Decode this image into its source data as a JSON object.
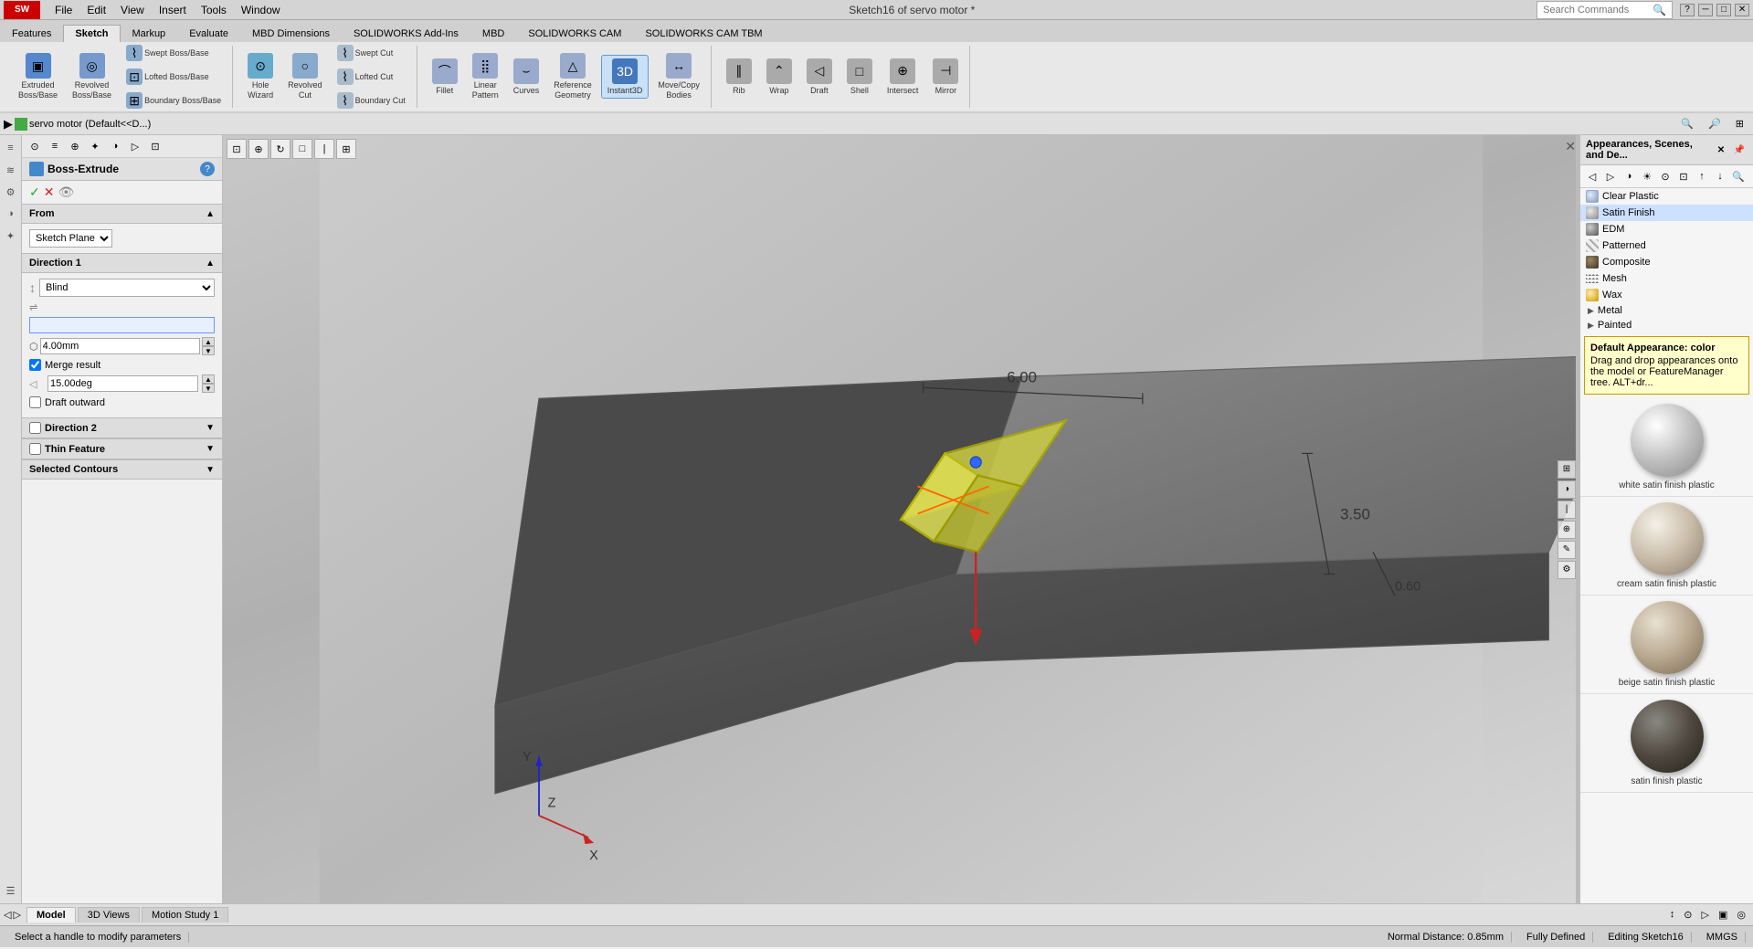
{
  "app": {
    "title": "Sketch16 of servo motor *",
    "logo": "SW"
  },
  "menu": {
    "items": [
      "File",
      "Edit",
      "View",
      "Insert",
      "Tools",
      "Window"
    ]
  },
  "ribbon_tabs": [
    "Features",
    "Sketch",
    "Markup",
    "Evaluate",
    "MBD Dimensions",
    "SOLIDWORKS Add-Ins",
    "MBD",
    "SOLIDWORKS CAM",
    "SOLIDWORKS CAM TBM"
  ],
  "active_tab": "Sketch",
  "ribbon_groups": {
    "features": [
      {
        "label": "Extruded\nBoss/Base",
        "icon": "▣"
      },
      {
        "label": "Revolved\nBoss/Base",
        "icon": "◎"
      },
      {
        "label": "Swept Boss/Base",
        "icon": "⌇"
      },
      {
        "label": "Lofted Boss/Base",
        "icon": "⊡"
      },
      {
        "label": "Boundary Boss/Base",
        "icon": "⊞"
      },
      {
        "label": "Hole\nWizard",
        "icon": "⊙"
      },
      {
        "label": "Revolved\nCut",
        "icon": "○"
      },
      {
        "label": "Swept Cut",
        "icon": "⌇"
      },
      {
        "label": "Lofted Cut",
        "icon": "⌇"
      },
      {
        "label": "Boundary Cut",
        "icon": "⌇"
      },
      {
        "label": "Fillet",
        "icon": "⌒"
      },
      {
        "label": "Linear\nPattern",
        "icon": "⣿"
      },
      {
        "label": "Curves",
        "icon": "⌣"
      },
      {
        "label": "Reference\nGeometry",
        "icon": "△"
      },
      {
        "label": "Instant3D",
        "icon": "3D"
      },
      {
        "label": "Rib",
        "icon": "∥"
      },
      {
        "label": "Wrap",
        "icon": "⌃"
      },
      {
        "label": "Draft",
        "icon": "◁"
      },
      {
        "label": "Shell",
        "icon": "□"
      },
      {
        "label": "Intersect",
        "icon": "⊕"
      },
      {
        "label": "Mirror",
        "icon": "⊣"
      },
      {
        "label": "Move/Copy\nBodies",
        "icon": "↔"
      }
    ]
  },
  "left_panel": {
    "title": "Boss-Extrude",
    "sections": {
      "from": {
        "label": "From",
        "value": "Sketch Plane"
      },
      "direction1": {
        "label": "Direction 1",
        "type_value": "Blind",
        "depth_value": "4.00mm",
        "merge_result": true,
        "draft_angle": "15.00deg",
        "draft_outward": false
      },
      "direction2": {
        "label": "Direction 2",
        "enabled": false
      },
      "thin_feature": {
        "label": "Thin Feature",
        "enabled": false
      },
      "selected_contours": {
        "label": "Selected Contours",
        "enabled": false
      }
    }
  },
  "viewport": {
    "breadcrumb": "servo motor (Default<<D...)",
    "model_label": "Sketch16"
  },
  "right_panel": {
    "title": "Appearances, Scenes, and De...",
    "categories": [
      {
        "label": "Clear Plastic",
        "type": "clear"
      },
      {
        "label": "Satin Finish",
        "type": "satin",
        "selected": true
      },
      {
        "label": "EDM",
        "type": "edm"
      },
      {
        "label": "Patterned",
        "type": "patterned"
      },
      {
        "label": "Composite",
        "type": "composite"
      },
      {
        "label": "Mesh",
        "type": "mesh"
      },
      {
        "label": "Wax",
        "type": "wax"
      }
    ],
    "tree_items": [
      {
        "label": "Metal",
        "expanded": false
      },
      {
        "label": "Painted",
        "expanded": false
      }
    ],
    "tooltip": {
      "title": "Default Appearance: color",
      "body": "Drag and drop appearances onto the model or FeatureManager tree. ALT+dr..."
    },
    "materials": [
      {
        "label": "white satin finish plastic",
        "sphere_class": "sphere-white"
      },
      {
        "label": "cream satin finish plastic",
        "sphere_class": "sphere-cream"
      },
      {
        "label": "beige satin finish plastic",
        "sphere_class": "sphere-beige"
      },
      {
        "label": "satin finish plastic",
        "sphere_class": "sphere-dark"
      }
    ]
  },
  "bottom_tabs": [
    "Model",
    "3D Views",
    "Motion Study 1"
  ],
  "active_bottom_tab": "Model",
  "status_bar": {
    "message": "Select a handle to modify parameters",
    "normal_distance": "Normal Distance: 0.85mm",
    "fully_defined": "Fully Defined",
    "editing": "Editing Sketch16",
    "units": "MMGS"
  },
  "search": {
    "placeholder": "Search Commands",
    "label": "Search Commands"
  }
}
